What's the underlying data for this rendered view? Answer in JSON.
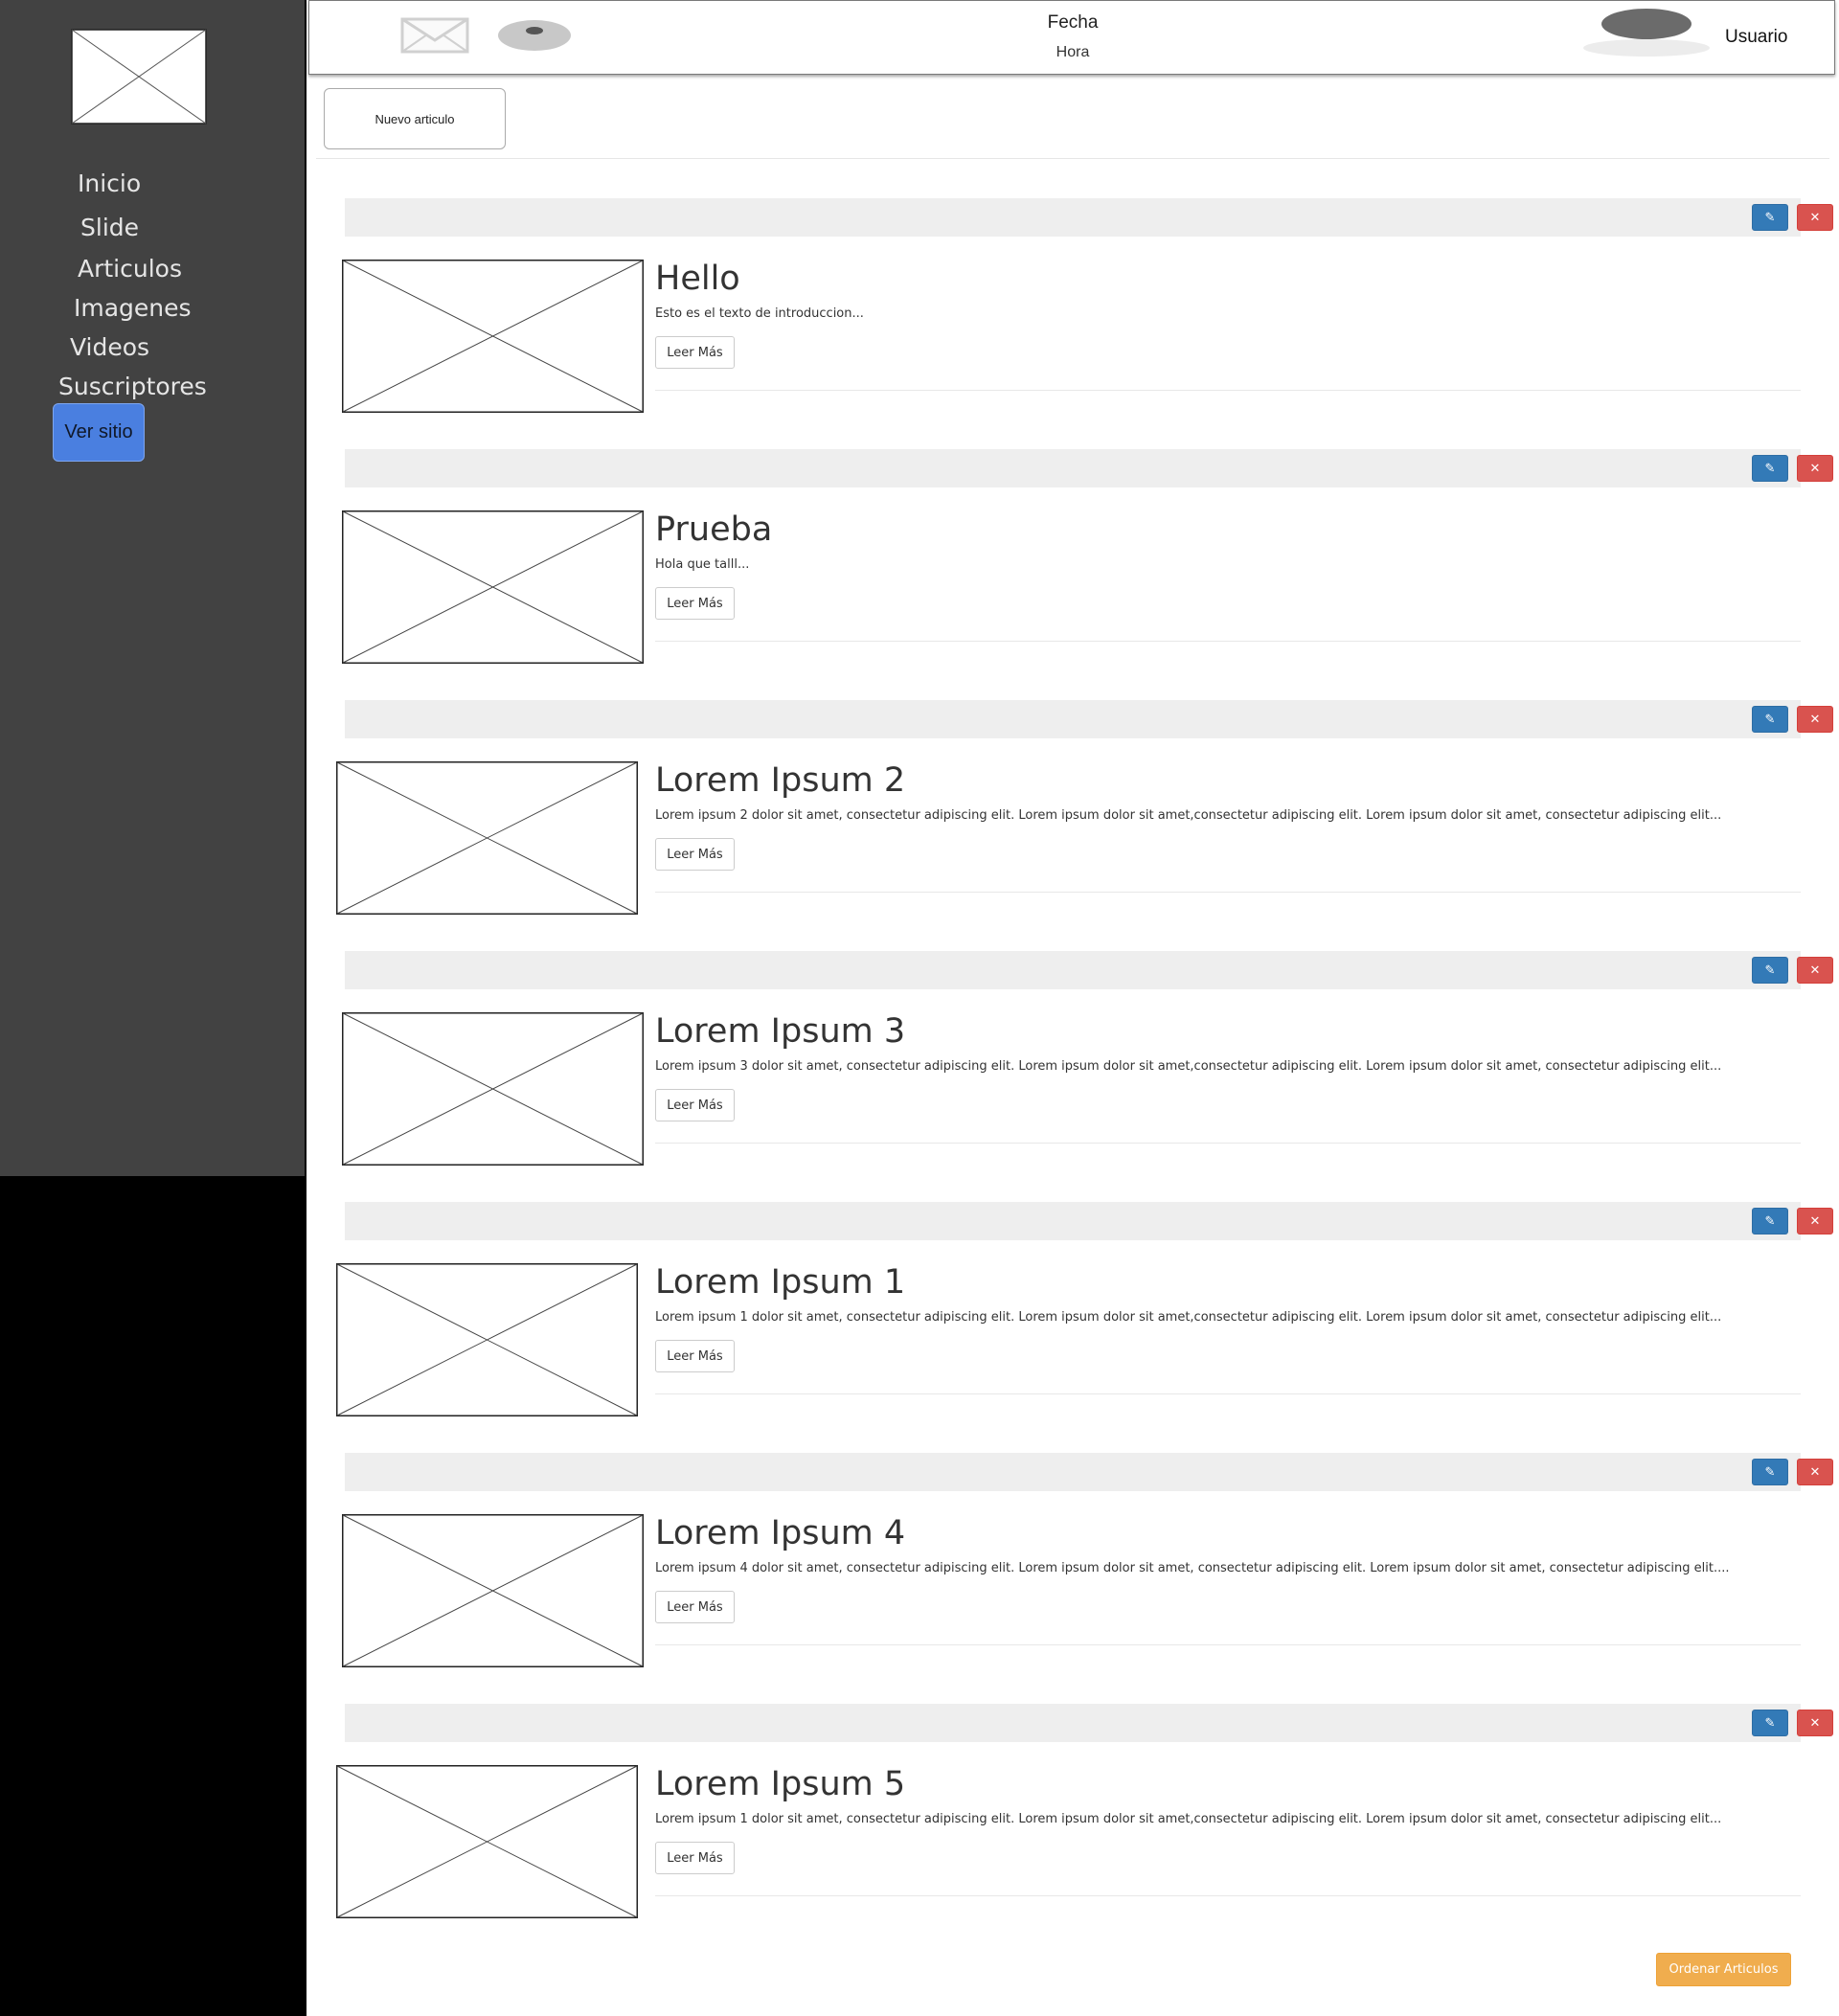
{
  "sidebar": {
    "items": [
      {
        "label": "Inicio"
      },
      {
        "label": "Slide"
      },
      {
        "label": "Articulos"
      },
      {
        "label": "Imagenes"
      },
      {
        "label": "Videos"
      },
      {
        "label": "Suscriptores"
      }
    ],
    "view_site_label": "Ver sitio"
  },
  "header": {
    "date_label": "Fecha",
    "time_label": "Hora",
    "user_label": "Usuario",
    "icons": [
      "mail-icon",
      "disk-icon",
      "avatar-icon"
    ]
  },
  "toolbar": {
    "new_article_label": "Nuevo articulo"
  },
  "articles": [
    {
      "title": "Hello",
      "intro": "Esto es el texto de introduccion...",
      "read_more": "Leer Más",
      "edit_icon": "pencil-icon",
      "delete_icon": "close-icon"
    },
    {
      "title": "Prueba",
      "intro": "Hola que talll...",
      "read_more": "Leer Más",
      "edit_icon": "pencil-icon",
      "delete_icon": "close-icon"
    },
    {
      "title": "Lorem Ipsum 2",
      "intro": "Lorem ipsum 2 dolor sit amet, consectetur adipiscing elit. Lorem ipsum dolor sit amet,consectetur adipiscing elit. Lorem ipsum dolor sit amet, consectetur adipiscing elit...",
      "read_more": "Leer Más",
      "edit_icon": "pencil-icon",
      "delete_icon": "close-icon"
    },
    {
      "title": "Lorem Ipsum 3",
      "intro": "Lorem ipsum 3 dolor sit amet, consectetur adipiscing elit. Lorem ipsum dolor sit amet,consectetur adipiscing elit. Lorem ipsum dolor sit amet, consectetur adipiscing elit...",
      "read_more": "Leer Más",
      "edit_icon": "pencil-icon",
      "delete_icon": "close-icon"
    },
    {
      "title": "Lorem Ipsum 1",
      "intro": "Lorem ipsum 1 dolor sit amet, consectetur adipiscing elit. Lorem ipsum dolor sit amet,consectetur adipiscing elit. Lorem ipsum dolor sit amet, consectetur adipiscing elit...",
      "read_more": "Leer Más",
      "edit_icon": "pencil-icon",
      "delete_icon": "close-icon"
    },
    {
      "title": "Lorem Ipsum 4",
      "intro": "Lorem ipsum 4 dolor sit amet, consectetur adipiscing elit. Lorem ipsum dolor sit amet, consectetur adipiscing elit. Lorem ipsum dolor sit amet, consectetur adipiscing elit....",
      "read_more": "Leer Más",
      "edit_icon": "pencil-icon",
      "delete_icon": "close-icon"
    },
    {
      "title": "Lorem Ipsum 5",
      "intro": "Lorem ipsum 1 dolor sit amet, consectetur adipiscing elit. Lorem ipsum dolor sit amet,consectetur adipiscing elit. Lorem ipsum dolor sit amet, consectetur adipiscing elit...",
      "read_more": "Leer Más",
      "edit_icon": "pencil-icon",
      "delete_icon": "close-icon"
    }
  ],
  "footer": {
    "order_label": "Ordenar Articulos"
  },
  "colors": {
    "sidebar_bg": "#424242",
    "view_site_button": "#4a7fe0",
    "edit_button": "#337ab7",
    "delete_button": "#d9534f",
    "order_button": "#f0ad4e",
    "article_bar": "#eeeeee"
  }
}
